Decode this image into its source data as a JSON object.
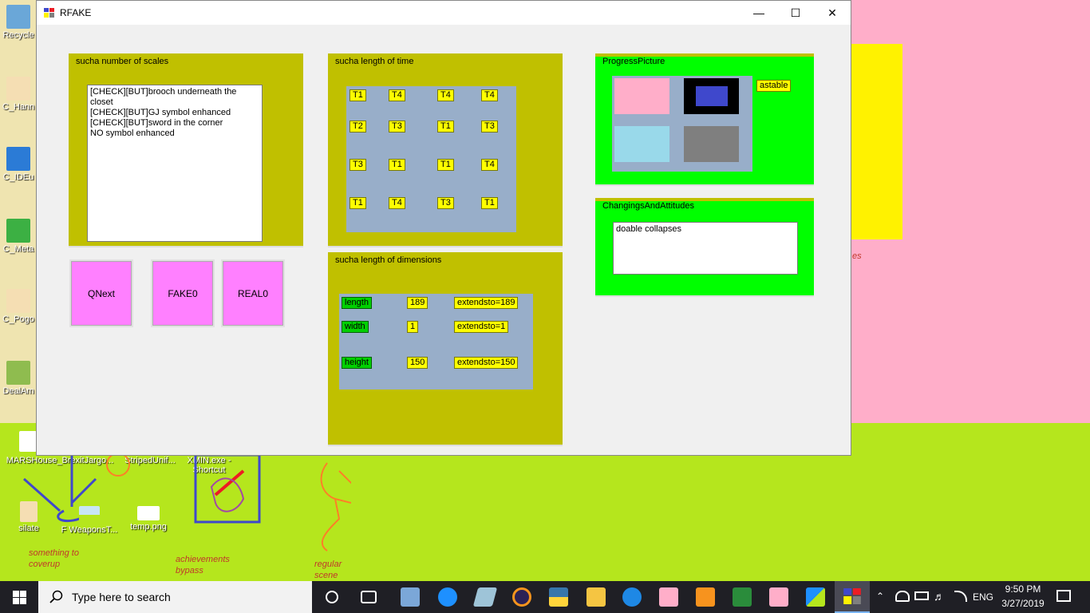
{
  "desktop": {
    "icons": [
      {
        "label": "Recycle",
        "color": "#6aa7d8"
      },
      {
        "label": "C_Hann",
        "color": "#f5deb3"
      },
      {
        "label": "C_IDEu",
        "color": "#2b7bd6"
      },
      {
        "label": "C_Meta",
        "color": "#3cb043"
      },
      {
        "label": "C_Pogo",
        "color": "#f5deb3"
      },
      {
        "label": "DealAm",
        "color": "#8fbc4f"
      },
      {
        "label": "MARSHouse_BrexitJargo...",
        "color": "#ffffff"
      },
      {
        "label": "StripedUnif...",
        "color": "#ffffff"
      },
      {
        "label": "XMIN.exe - Shortcut",
        "color": "#ffffff"
      },
      {
        "label": "silate",
        "color": "#f5deb3"
      },
      {
        "label": "F WeaponsT...",
        "color": "#c8e6f5"
      },
      {
        "label": "temp.png",
        "color": "#ffffff"
      }
    ],
    "notes": {
      "note1": "something to coverup",
      "note2": "achievements bypass",
      "note3": "regular scene",
      "note4": "es"
    }
  },
  "window": {
    "title": "RFAKE",
    "controls": {
      "minimize": "—",
      "maximize": "☐",
      "close": "✕"
    },
    "scales": {
      "label": "sucha number of scales",
      "items": [
        "[CHECK][BUT]brooch underneath the closet",
        "[CHECK][BUT]GJ symbol enhanced",
        "[CHECK][BUT]sword in the corner",
        "NO symbol enhanced"
      ]
    },
    "buttons": {
      "qnext": "QNext",
      "fake": "FAKE0",
      "real": "REAL0"
    },
    "time": {
      "label": "sucha length of time",
      "grid": [
        [
          "T1",
          "T4",
          "T4",
          "T4"
        ],
        [
          "T2",
          "T3",
          "T1",
          "T3"
        ],
        [
          "T3",
          "T1",
          "T1",
          "T4"
        ],
        [
          "T1",
          "T4",
          "T3",
          "T1"
        ]
      ]
    },
    "dimensions": {
      "label": "sucha length of dimensions",
      "rows": [
        {
          "name": "length",
          "value": "189",
          "extend": "extendsto=189"
        },
        {
          "name": "width",
          "value": "1",
          "extend": "extendsto=1"
        },
        {
          "name": "height",
          "value": "150",
          "extend": "extendsto=150"
        }
      ]
    },
    "progress": {
      "label": "ProgressPicture",
      "badge": "astable",
      "swatches": {
        "pink": "#ffaec9",
        "black": "#000000",
        "blue_inner": "#3f48cc",
        "lightblue": "#99d9ea",
        "gray": "#7f7f7f"
      }
    },
    "changes": {
      "label": "ChangingsAndAttitudes",
      "text": "doable collapses"
    }
  },
  "taskbar": {
    "search_placeholder": "Type here to search",
    "time": "9:50 PM",
    "date": "3/27/2019",
    "lang": "ENG",
    "apps": [
      "task-view",
      "store",
      "edge",
      "sketch",
      "eclipse",
      "python",
      "explorer",
      "search-app",
      "app-1",
      "app-2",
      "app-3",
      "app-4",
      "app-5",
      "app-6"
    ]
  }
}
